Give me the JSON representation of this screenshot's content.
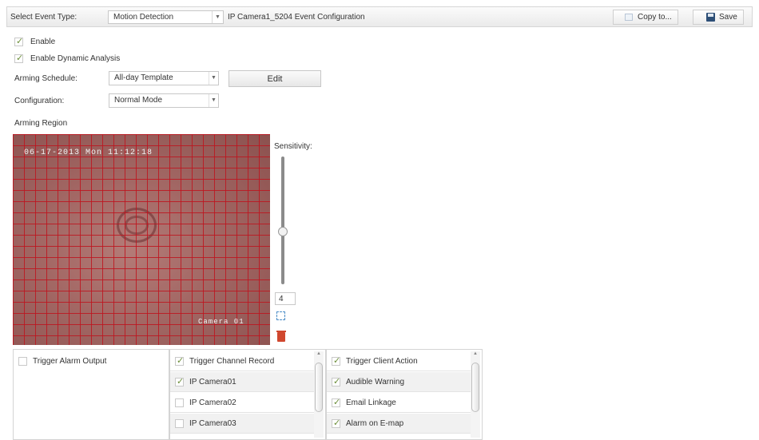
{
  "toolbar": {
    "event_type_label": "Select Event Type:",
    "event_type_value": "Motion Detection",
    "config_title": "IP Camera1_5204 Event Configuration",
    "copy_label": "Copy to...",
    "save_label": "Save"
  },
  "options": {
    "enable_label": "Enable",
    "enable_checked": true,
    "dynamic_label": "Enable Dynamic Analysis",
    "dynamic_checked": true
  },
  "form": {
    "arming_schedule_label": "Arming Schedule:",
    "arming_schedule_value": "All-day Template",
    "edit_label": "Edit",
    "configuration_label": "Configuration:",
    "configuration_value": "Normal Mode",
    "arming_region_label": "Arming Region"
  },
  "video": {
    "osd_time": "06-17-2013 Mon 11:12:18",
    "osd_camera": "Camera 01"
  },
  "sensitivity": {
    "label": "Sensitivity:",
    "value": "4",
    "level": 0.41
  },
  "panels": {
    "alarm_output": {
      "label": "Trigger Alarm Output",
      "checked": false
    },
    "channel_record": {
      "items": [
        {
          "label": "Trigger Channel Record",
          "checked": true
        },
        {
          "label": "IP Camera01",
          "checked": true
        },
        {
          "label": "IP Camera02",
          "checked": false
        },
        {
          "label": "IP Camera03",
          "checked": false
        }
      ]
    },
    "client_action": {
      "items": [
        {
          "label": "Trigger Client Action",
          "checked": true
        },
        {
          "label": "Audible Warning",
          "checked": true
        },
        {
          "label": "Email Linkage",
          "checked": true
        },
        {
          "label": "Alarm on E-map",
          "checked": true
        }
      ]
    }
  }
}
